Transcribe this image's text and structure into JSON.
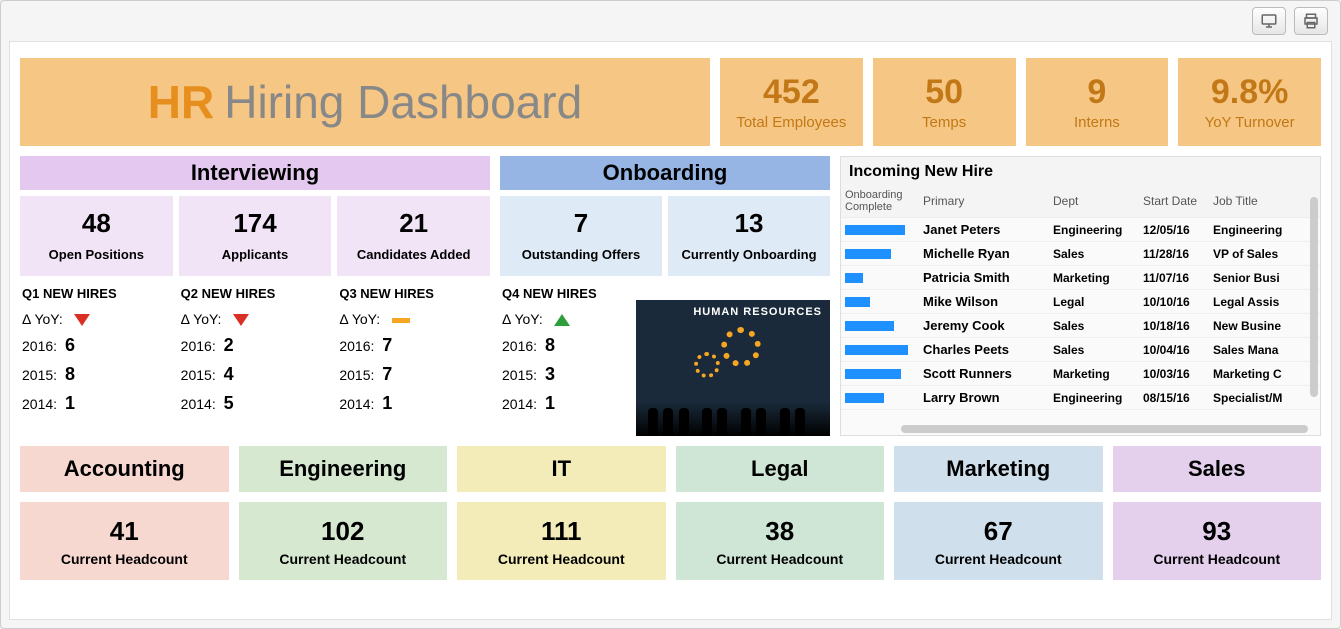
{
  "toolbar": {
    "present_name": "present-icon",
    "print_name": "print-icon"
  },
  "title": {
    "prefix": "HR",
    "rest": "Hiring Dashboard"
  },
  "kpis": [
    {
      "value": "452",
      "label": "Total Employees"
    },
    {
      "value": "50",
      "label": "Temps"
    },
    {
      "value": "9",
      "label": "Interns"
    },
    {
      "value": "9.8%",
      "label": "YoY Turnover"
    }
  ],
  "interviewing": {
    "header": "Interviewing",
    "cards": [
      {
        "value": "48",
        "label": "Open Positions"
      },
      {
        "value": "174",
        "label": "Applicants"
      },
      {
        "value": "21",
        "label": "Candidates Added"
      }
    ]
  },
  "onboarding": {
    "header": "Onboarding",
    "cards": [
      {
        "value": "7",
        "label": "Outstanding Offers"
      },
      {
        "value": "13",
        "label": "Currently Onboarding"
      }
    ]
  },
  "quarters": [
    {
      "title": "Q1 NEW HIRES",
      "delta_label": "Δ YoY:",
      "trend": "down",
      "y2016_l": "2016:",
      "y2016": "6",
      "y2015_l": "2015:",
      "y2015": "8",
      "y2014_l": "2014:",
      "y2014": "1"
    },
    {
      "title": "Q2 NEW HIRES",
      "delta_label": "Δ YoY:",
      "trend": "down",
      "y2016_l": "2016:",
      "y2016": "2",
      "y2015_l": "2015:",
      "y2015": "4",
      "y2014_l": "2014:",
      "y2014": "5"
    },
    {
      "title": "Q3 NEW HIRES",
      "delta_label": "Δ YoY:",
      "trend": "flat",
      "y2016_l": "2016:",
      "y2016": "7",
      "y2015_l": "2015:",
      "y2015": "7",
      "y2014_l": "2014:",
      "y2014": "1"
    },
    {
      "title": "Q4 NEW HIRES",
      "delta_label": "Δ YoY:",
      "trend": "up",
      "y2016_l": "2016:",
      "y2016": "8",
      "y2015_l": "2015:",
      "y2015": "3",
      "y2014_l": "2014:",
      "y2014": "1"
    }
  ],
  "hr_image_caption": "HUMAN RESOURCES",
  "table": {
    "title": "Incoming New Hire",
    "headers": {
      "progress": "Onboarding Complete",
      "primary": "Primary",
      "dept": "Dept",
      "start": "Start Date",
      "job": "Job Title"
    },
    "rows": [
      {
        "progress": 85,
        "primary": "Janet Peters",
        "dept": "Engineering",
        "start": "12/05/16",
        "job": "Engineering"
      },
      {
        "progress": 65,
        "primary": "Michelle Ryan",
        "dept": "Sales",
        "start": "11/28/16",
        "job": "VP of Sales"
      },
      {
        "progress": 25,
        "primary": "Patricia Smith",
        "dept": "Marketing",
        "start": "11/07/16",
        "job": "Senior Busi"
      },
      {
        "progress": 35,
        "primary": "Mike Wilson",
        "dept": "Legal",
        "start": "10/10/16",
        "job": "Legal Assis"
      },
      {
        "progress": 70,
        "primary": "Jeremy Cook",
        "dept": "Sales",
        "start": "10/18/16",
        "job": "New Busine"
      },
      {
        "progress": 90,
        "primary": "Charles Peets",
        "dept": "Sales",
        "start": "10/04/16",
        "job": "Sales Mana"
      },
      {
        "progress": 80,
        "primary": "Scott Runners",
        "dept": "Marketing",
        "start": "10/03/16",
        "job": "Marketing C"
      },
      {
        "progress": 55,
        "primary": "Larry Brown",
        "dept": "Engineering",
        "start": "08/15/16",
        "job": "Specialist/M"
      }
    ]
  },
  "departments": [
    {
      "name": "Accounting",
      "headcount": "41",
      "label": "Current Headcount",
      "cls": "c-acc"
    },
    {
      "name": "Engineering",
      "headcount": "102",
      "label": "Current Headcount",
      "cls": "c-eng"
    },
    {
      "name": "IT",
      "headcount": "111",
      "label": "Current Headcount",
      "cls": "c-it"
    },
    {
      "name": "Legal",
      "headcount": "38",
      "label": "Current Headcount",
      "cls": "c-leg"
    },
    {
      "name": "Marketing",
      "headcount": "67",
      "label": "Current Headcount",
      "cls": "c-mkt"
    },
    {
      "name": "Sales",
      "headcount": "93",
      "label": "Current Headcount",
      "cls": "c-sal"
    }
  ]
}
